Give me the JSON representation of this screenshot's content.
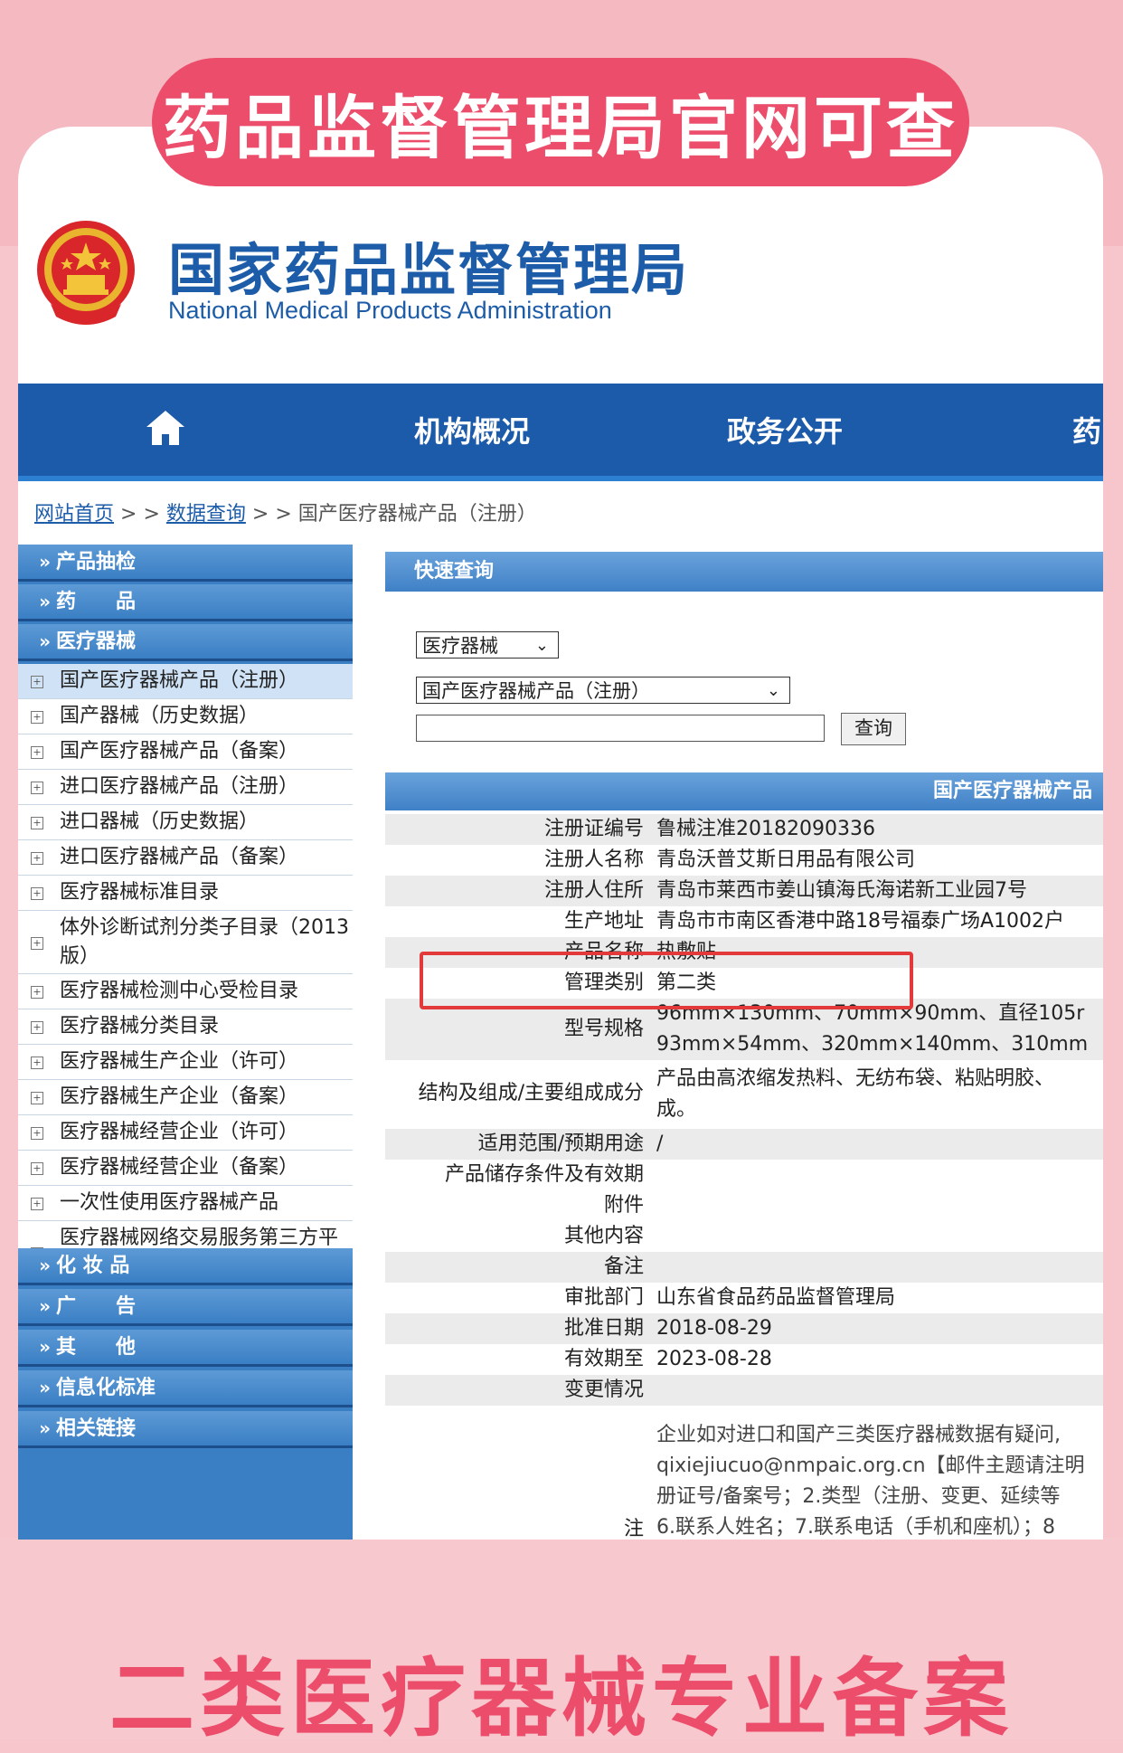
{
  "banner_top": "药品监督管理局官网可查",
  "banner_bottom": "二类医疗器械专业备案",
  "header": {
    "title": "国家药品监督管理局",
    "subtitle": "National Medical Products Administration"
  },
  "nav": {
    "items": [
      "机构概况",
      "政务公开",
      "药"
    ]
  },
  "breadcrumb": {
    "home": "网站首页",
    "sep": "> >",
    "query": "数据查询",
    "current": "国产医疗器械产品（注册）"
  },
  "sidebar": {
    "categories_top": [
      "产品抽检",
      "药　　品",
      "医疗器械"
    ],
    "sub_items": [
      "国产医疗器械产品（注册）",
      "国产器械（历史数据）",
      "国产医疗器械产品（备案）",
      "进口医疗器械产品（注册）",
      "进口器械（历史数据）",
      "进口医疗器械产品（备案）",
      "医疗器械标准目录",
      "体外诊断试剂分类子目录（2013版）",
      "医疗器械检测中心受检目录",
      "医疗器械分类目录",
      "医疗器械生产企业（许可）",
      "医疗器械生产企业（备案）",
      "医疗器械经营企业（许可）",
      "医疗器械经营企业（备案）",
      "一次性使用医疗器械产品",
      "医疗器械网络交易服务第三方平台"
    ],
    "categories_bottom": [
      "化 妆 品",
      "广　　告",
      "其　　他",
      "信息化标准",
      "相关链接"
    ]
  },
  "query": {
    "panel_title": "快速查询",
    "select1": "医疗器械",
    "select2": "国产医疗器械产品（注册）",
    "button": "查询"
  },
  "result": {
    "title": "国产医疗器械产品",
    "fields": [
      {
        "label": "注册证编号",
        "value": "鲁械注准20182090336"
      },
      {
        "label": "注册人名称",
        "value": "青岛沃普艾斯日用品有限公司"
      },
      {
        "label": "注册人住所",
        "value": "青岛市莱西市姜山镇海氏海诺新工业园7号"
      },
      {
        "label": "生产地址",
        "value": "青岛市市南区香港中路18号福泰广场A1002户"
      },
      {
        "label": "产品名称",
        "value": "热敷贴"
      },
      {
        "label": "管理类别",
        "value": "第二类"
      },
      {
        "label": "型号规格",
        "value": "96mm×130mm、70mm×90mm、直径105r",
        "value2": "93mm×54mm、320mm×140mm、310mm"
      },
      {
        "label": "结构及组成/主要组成成分",
        "value": "产品由高浓缩发热料、无纺布袋、粘贴明胶、",
        "value2": "成。"
      },
      {
        "label": "适用范围/预期用途",
        "value": "/"
      },
      {
        "label": "产品储存条件及有效期",
        "value": ""
      },
      {
        "label": "附件",
        "value": ""
      },
      {
        "label": "其他内容",
        "value": ""
      },
      {
        "label": "备注",
        "value": ""
      },
      {
        "label": "审批部门",
        "value": "山东省食品药品监督管理局"
      },
      {
        "label": "批准日期",
        "value": "2018-08-29"
      },
      {
        "label": "有效期至",
        "value": "2023-08-28"
      },
      {
        "label": "变更情况",
        "value": ""
      },
      {
        "label": "注",
        "value": "企业如对进口和国产三类医疗器械数据有疑问,",
        "value2": "qixiejiucuo@nmpaic.org.cn【邮件主题请注明",
        "value3": "册证号/备案号；2.类型（注册、变更、延续等",
        "value4": "6.联系人姓名；7.联系电话（手机和座机）；8"
      }
    ]
  }
}
